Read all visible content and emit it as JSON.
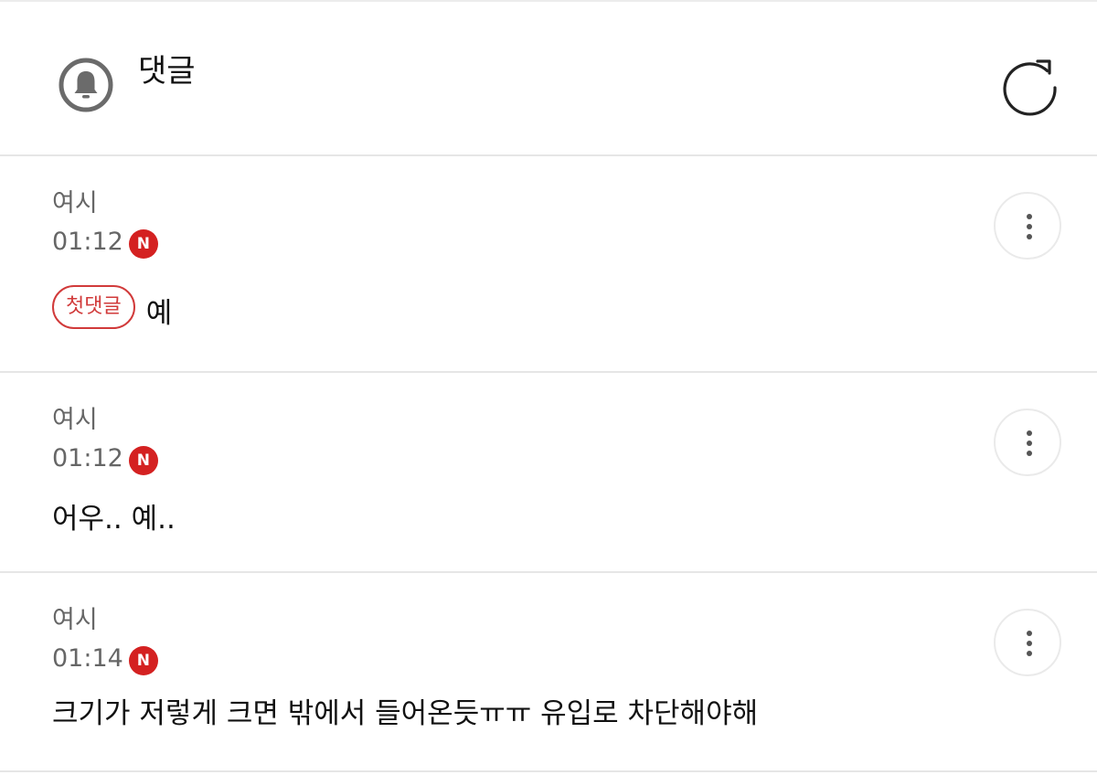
{
  "header": {
    "title": "댓글",
    "icon": "bell-icon",
    "refresh_icon": "refresh-icon"
  },
  "colors": {
    "accent": "#d42121",
    "tag": "#d13a3a",
    "meta_text": "#666666",
    "divider": "#e6e6e6"
  },
  "comments": [
    {
      "author": "여시",
      "time": "01:12",
      "new_badge": "N",
      "tag": "첫댓글",
      "text": "예",
      "more_icon": "more-vertical-icon"
    },
    {
      "author": "여시",
      "time": "01:12",
      "new_badge": "N",
      "text": "어우.. 예..",
      "more_icon": "more-vertical-icon"
    },
    {
      "author": "여시",
      "time": "01:14",
      "new_badge": "N",
      "text": "크기가 저렇게 크면 밖에서 들어온듯ㅠㅠ 유입로 차단해야해",
      "more_icon": "more-vertical-icon"
    }
  ]
}
